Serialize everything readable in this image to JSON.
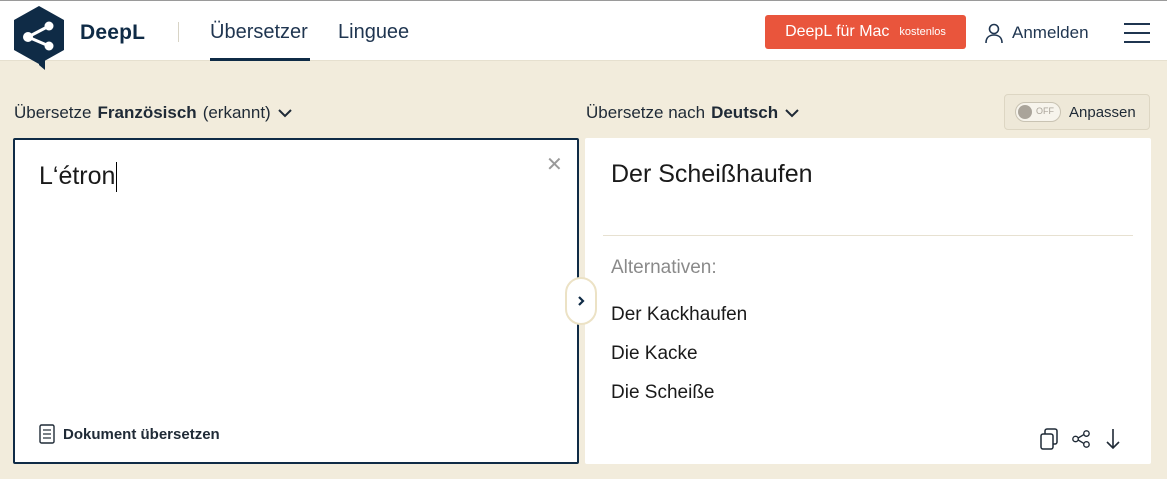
{
  "header": {
    "logo_text": "DeepL",
    "nav": [
      "Übersetzer",
      "Linguee"
    ],
    "cta": {
      "main": "DeepL für Mac",
      "sub": "kostenlos"
    },
    "login_label": "Anmelden"
  },
  "source": {
    "prefix": "Übersetze",
    "language": "Französisch",
    "suffix": "(erkannt)",
    "text": "L‘étron",
    "document_button": "Dokument übersetzen"
  },
  "target": {
    "prefix": "Übersetze nach",
    "language": "Deutsch",
    "translation": "Der Scheißhaufen",
    "alternatives_title": "Alternativen:",
    "alternatives": [
      "Der Kackhaufen",
      "Die Kacke",
      "Die Scheiße"
    ]
  },
  "adapt": {
    "toggle_state": "OFF",
    "label": "Anpassen"
  },
  "colors": {
    "accent": "#e9553c",
    "navy": "#0f2b46",
    "background": "#f2ecdc"
  },
  "icons": [
    "deepl-logo-icon",
    "user-icon",
    "hamburger-menu-icon",
    "chevron-down-icon",
    "close-icon",
    "document-icon",
    "chevron-right-icon",
    "copy-icon",
    "share-icon",
    "download-icon"
  ]
}
